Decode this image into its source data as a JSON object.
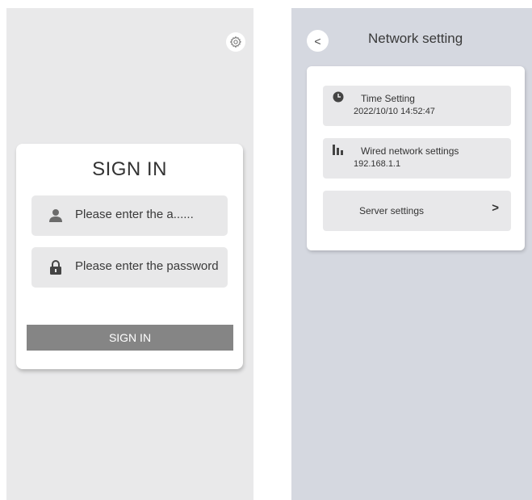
{
  "signin": {
    "gear_icon": "gear-icon",
    "title": "SIGN IN",
    "account_placeholder": "Please enter the a......",
    "password_placeholder": "Please enter the password",
    "button_label": "SIGN IN",
    "account_icon": "user-icon",
    "password_icon": "lock-icon"
  },
  "network": {
    "back_label": "<",
    "title": "Network setting",
    "items": [
      {
        "icon": "clock-icon",
        "title": "Time Setting",
        "value": "2022/10/10   14:52:47"
      },
      {
        "icon": "bars-icon",
        "title": "Wired network settings",
        "value": "192.168.1.1"
      },
      {
        "icon": "",
        "title": "Server settings",
        "value": "",
        "chevron": ">"
      }
    ]
  },
  "colors": {
    "left_bg": "#e9e9ea",
    "right_bg": "#d5d8e0",
    "button_bg": "#858585",
    "field_bg": "#e8e8e9"
  }
}
